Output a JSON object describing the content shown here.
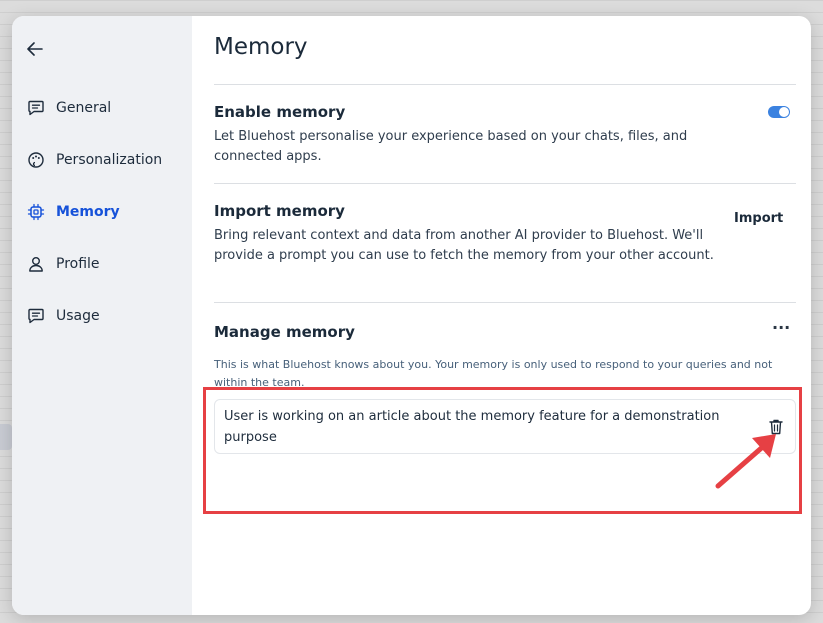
{
  "sidebar": {
    "items": [
      {
        "label": "General",
        "icon": "chat-bubble-icon",
        "active": false
      },
      {
        "label": "Personalization",
        "icon": "palette-icon",
        "active": false
      },
      {
        "label": "Memory",
        "icon": "chip-icon",
        "active": true
      },
      {
        "label": "Profile",
        "icon": "user-icon",
        "active": false
      },
      {
        "label": "Usage",
        "icon": "chat-bubble-icon",
        "active": false
      }
    ]
  },
  "main": {
    "title": "Memory",
    "enable": {
      "heading": "Enable memory",
      "description": "Let Bluehost personalise your experience based on your chats, files, and connected apps.",
      "enabled": true
    },
    "import": {
      "heading": "Import memory",
      "description": "Bring relevant context and data from another AI provider to Bluehost. We'll provide a prompt you can use to fetch the memory from your other account.",
      "button_label": "Import"
    },
    "manage": {
      "heading": "Manage memory",
      "more_label": "···",
      "description": "This is what Bluehost knows about you. Your memory is only used to respond to your queries and not within the team.",
      "items": [
        {
          "text": "User is working on an article about the memory feature for a demonstration purpose"
        }
      ]
    }
  },
  "colors": {
    "accent": "#1652d9",
    "toggle": "#3b82e0",
    "annotation": "#e64044"
  }
}
